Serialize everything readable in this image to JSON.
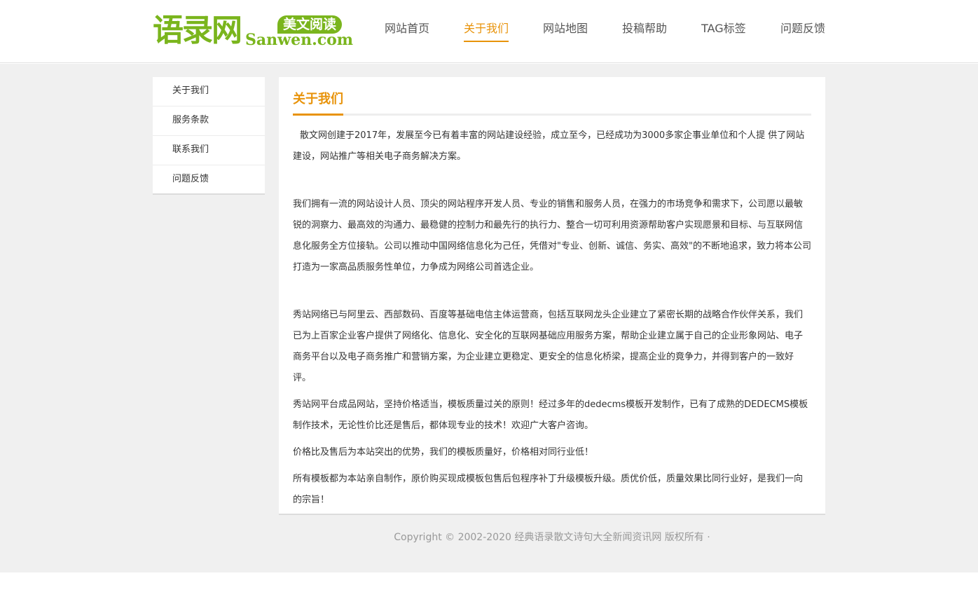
{
  "header": {
    "logo": {
      "cn": "语录网",
      "badge": "美文阅读",
      "en": "Sanwen.com"
    },
    "nav": [
      {
        "label": "网站首页",
        "active": false
      },
      {
        "label": "关于我们",
        "active": true
      },
      {
        "label": "网站地图",
        "active": false
      },
      {
        "label": "投稿帮助",
        "active": false
      },
      {
        "label": "TAG标签",
        "active": false
      },
      {
        "label": "问题反馈",
        "active": false
      }
    ]
  },
  "sidebar": {
    "items": [
      {
        "label": "关于我们"
      },
      {
        "label": "服务条款"
      },
      {
        "label": "联系我们"
      },
      {
        "label": "问题反馈"
      }
    ]
  },
  "content": {
    "title": "关于我们",
    "paragraphs": [
      "散文网创建于2017年，发展至今已有着丰富的网站建设经验，成立至今，已经成功为3000多家企事业单位和个人提 供了网站建设，网站推广等相关电子商务解决方案。",
      "我们拥有一流的网站设计人员、顶尖的网站程序开发人员、专业的销售和服务人员，在强力的市场竞争和需求下，公司愿以最敏锐的洞察力、最高效的沟通力、最稳健的控制力和最先行的执行力、整合一切可利用资源帮助客户实现愿景和目标、与互联网信息化服务全方位接轨。公司以推动中国网络信息化为己任，凭借对\"专业、创新、诚信、务实、高效\"的不断地追求，致力将本公司打造为一家高品质服务性单位，力争成为网络公司首选企业。",
      "秀站网络已与阿里云、西部数码、百度等基础电信主体运营商，包括互联网龙头企业建立了紧密长期的战略合作伙伴关系，我们已为上百家企业客户提供了网络化、信息化、安全化的互联网基础应用服务方案，帮助企业建立属于自己的企业形象网站、电子商务平台以及电子商务推广和营销方案，为企业建立更稳定、更安全的信息化桥梁，提高企业的竟争力，并得到客户的一致好评。",
      "秀站网平台成品网站，坚持价格适当，模板质量过关的原则！经过多年的dedecms模板开发制作，已有了成熟的DEDECMS模板制作技术，无论性价比还是售后，都体现专业的技术！欢迎广大客户咨询。",
      "价格比及售后为本站突出的优势，我们的模板质量好，价格相对同行业低！",
      "所有模板都为本站亲自制作，原价购买现成模板包售后包程序补丁升级模板升级。质优价低，质量效果比同行业好，是我们一向的宗旨！"
    ]
  },
  "footer": {
    "copyright": "Copyright © 2002-2020 经典语录散文诗句大全新闻资讯网 版权所有 ·"
  },
  "colors": {
    "brand_green": "#7ab51d",
    "accent_orange": "#e8930a",
    "page_bg": "#f0f0f0"
  }
}
